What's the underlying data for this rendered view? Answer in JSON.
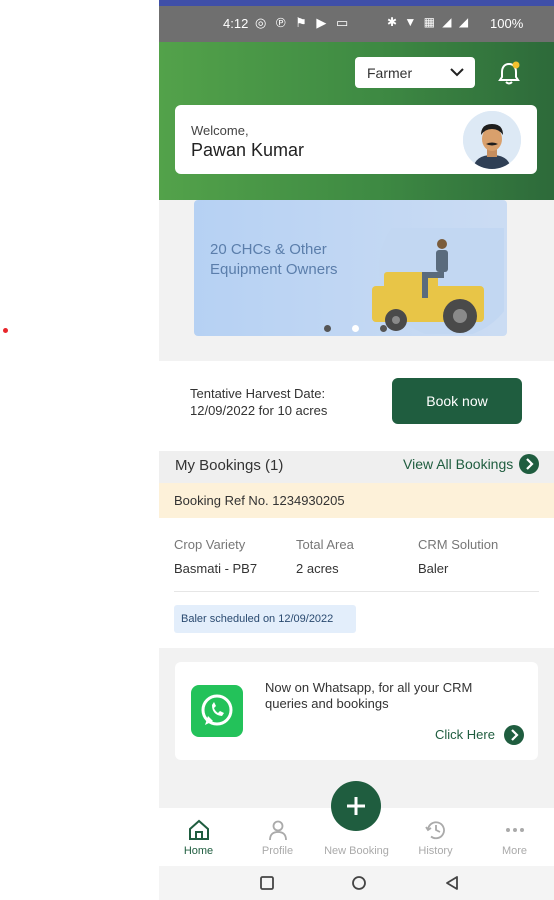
{
  "status_bar": {
    "time": "4:12",
    "app_icons": "◎ ℗ ⚑ ▶ ▭",
    "system_icons": "✱ ▼ ▦ ◢ ◢",
    "battery": "100%"
  },
  "header": {
    "role_value": "Farmer",
    "welcome_label": "Welcome,",
    "user_name": "Pawan Kumar"
  },
  "banner": {
    "text": "20 CHCs & Other Equipment Owners",
    "active_dot": 1,
    "dot_count": 3
  },
  "harvest": {
    "line1": "Tentative Harvest Date:",
    "line2": "12/09/2022 for 10 acres",
    "book_label": "Book now"
  },
  "bookings": {
    "title": "My Bookings (1)",
    "view_all": "View All Bookings",
    "ref": "Booking Ref No. 1234930205",
    "columns": [
      {
        "header": "Crop Variety",
        "value": "Basmati - PB7"
      },
      {
        "header": "Total Area",
        "value": "2 acres"
      },
      {
        "header": "CRM Solution",
        "value": "Baler"
      }
    ],
    "schedule": "Baler scheduled on 12/09/2022"
  },
  "whatsapp": {
    "message": "Now on Whatsapp, for all your CRM queries and bookings",
    "cta": "Click Here"
  },
  "nav": {
    "home": "Home",
    "profile": "Profile",
    "new_booking": "New Booking",
    "history": "History",
    "more": "More"
  },
  "colors": {
    "brand_green": "#1f5d3f",
    "header_green": "#53a24a",
    "ref_bar": "#fdf1d9",
    "whatsapp_green": "#23c25a"
  }
}
